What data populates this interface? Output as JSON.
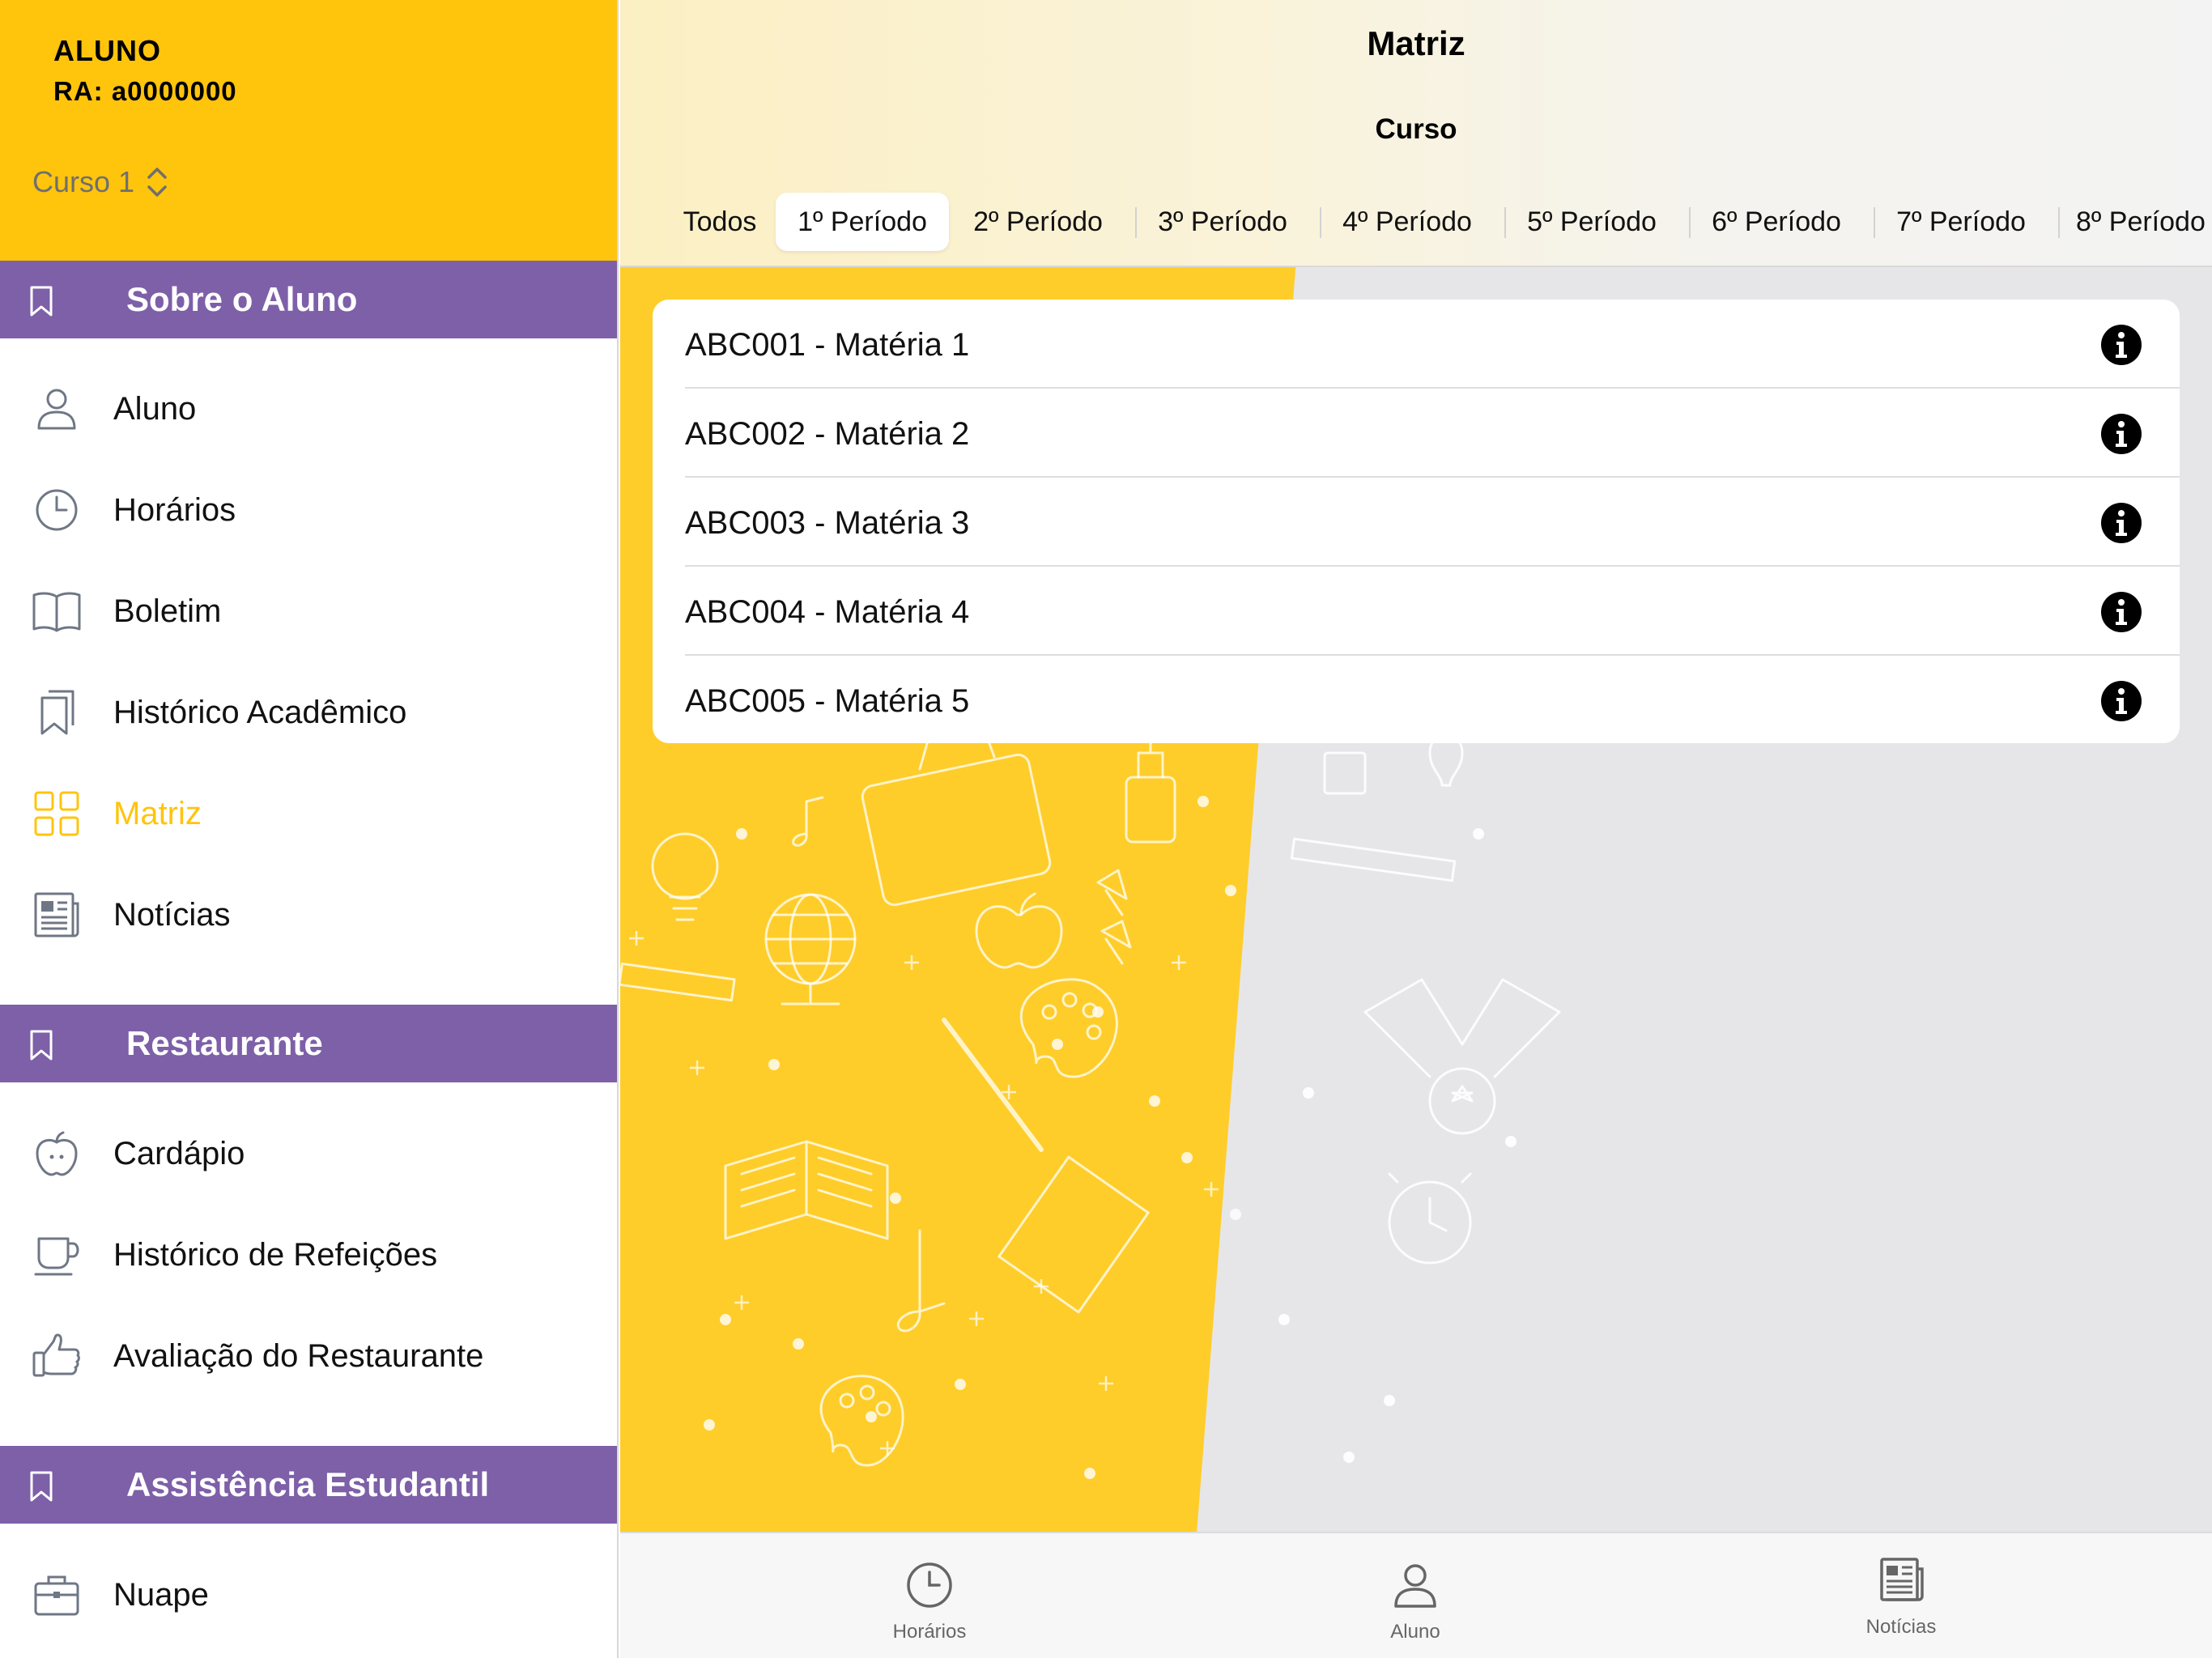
{
  "sidebar": {
    "profile": {
      "name": "ALUNO",
      "ra": "RA: a0000000",
      "course": "Curso 1"
    },
    "sections": [
      {
        "title": "Sobre o Aluno",
        "items": [
          {
            "label": "Aluno",
            "icon": "person-icon"
          },
          {
            "label": "Horários",
            "icon": "clock-icon"
          },
          {
            "label": "Boletim",
            "icon": "book-icon"
          },
          {
            "label": "Histórico Acadêmico",
            "icon": "bookmarks-icon"
          },
          {
            "label": "Matriz",
            "icon": "grid-icon",
            "active": true
          },
          {
            "label": "Notícias",
            "icon": "newspaper-icon"
          }
        ]
      },
      {
        "title": "Restaurante",
        "items": [
          {
            "label": "Cardápio",
            "icon": "apple-icon"
          },
          {
            "label": "Histórico de Refeições",
            "icon": "cup-icon"
          },
          {
            "label": "Avaliação do Restaurante",
            "icon": "thumbs-up-icon"
          }
        ]
      },
      {
        "title": "Assistência Estudantil",
        "items": [
          {
            "label": "Nuape",
            "icon": "briefcase-icon"
          }
        ]
      }
    ]
  },
  "main": {
    "title": "Matriz",
    "subtitle": "Curso",
    "tabs": [
      "Todos",
      "1º Período",
      "2º Período",
      "3º Período",
      "4º Período",
      "5º Período",
      "6º Período",
      "7º Período",
      "8º Período"
    ],
    "selected_tab": "1º Período",
    "subjects": [
      "ABC001 - Matéria 1",
      "ABC002 - Matéria 2",
      "ABC003 - Matéria 3",
      "ABC004 - Matéria 4",
      "ABC005 - Matéria 5"
    ]
  },
  "tabbar": {
    "items": [
      {
        "label": "Horários",
        "icon": "clock-icon"
      },
      {
        "label": "Aluno",
        "icon": "person-icon"
      },
      {
        "label": "Notícias",
        "icon": "newspaper-icon"
      }
    ]
  },
  "colors": {
    "accent_yellow": "#ffc40c",
    "section_purple": "#7d60a8",
    "icon_gray": "#6f7785"
  }
}
